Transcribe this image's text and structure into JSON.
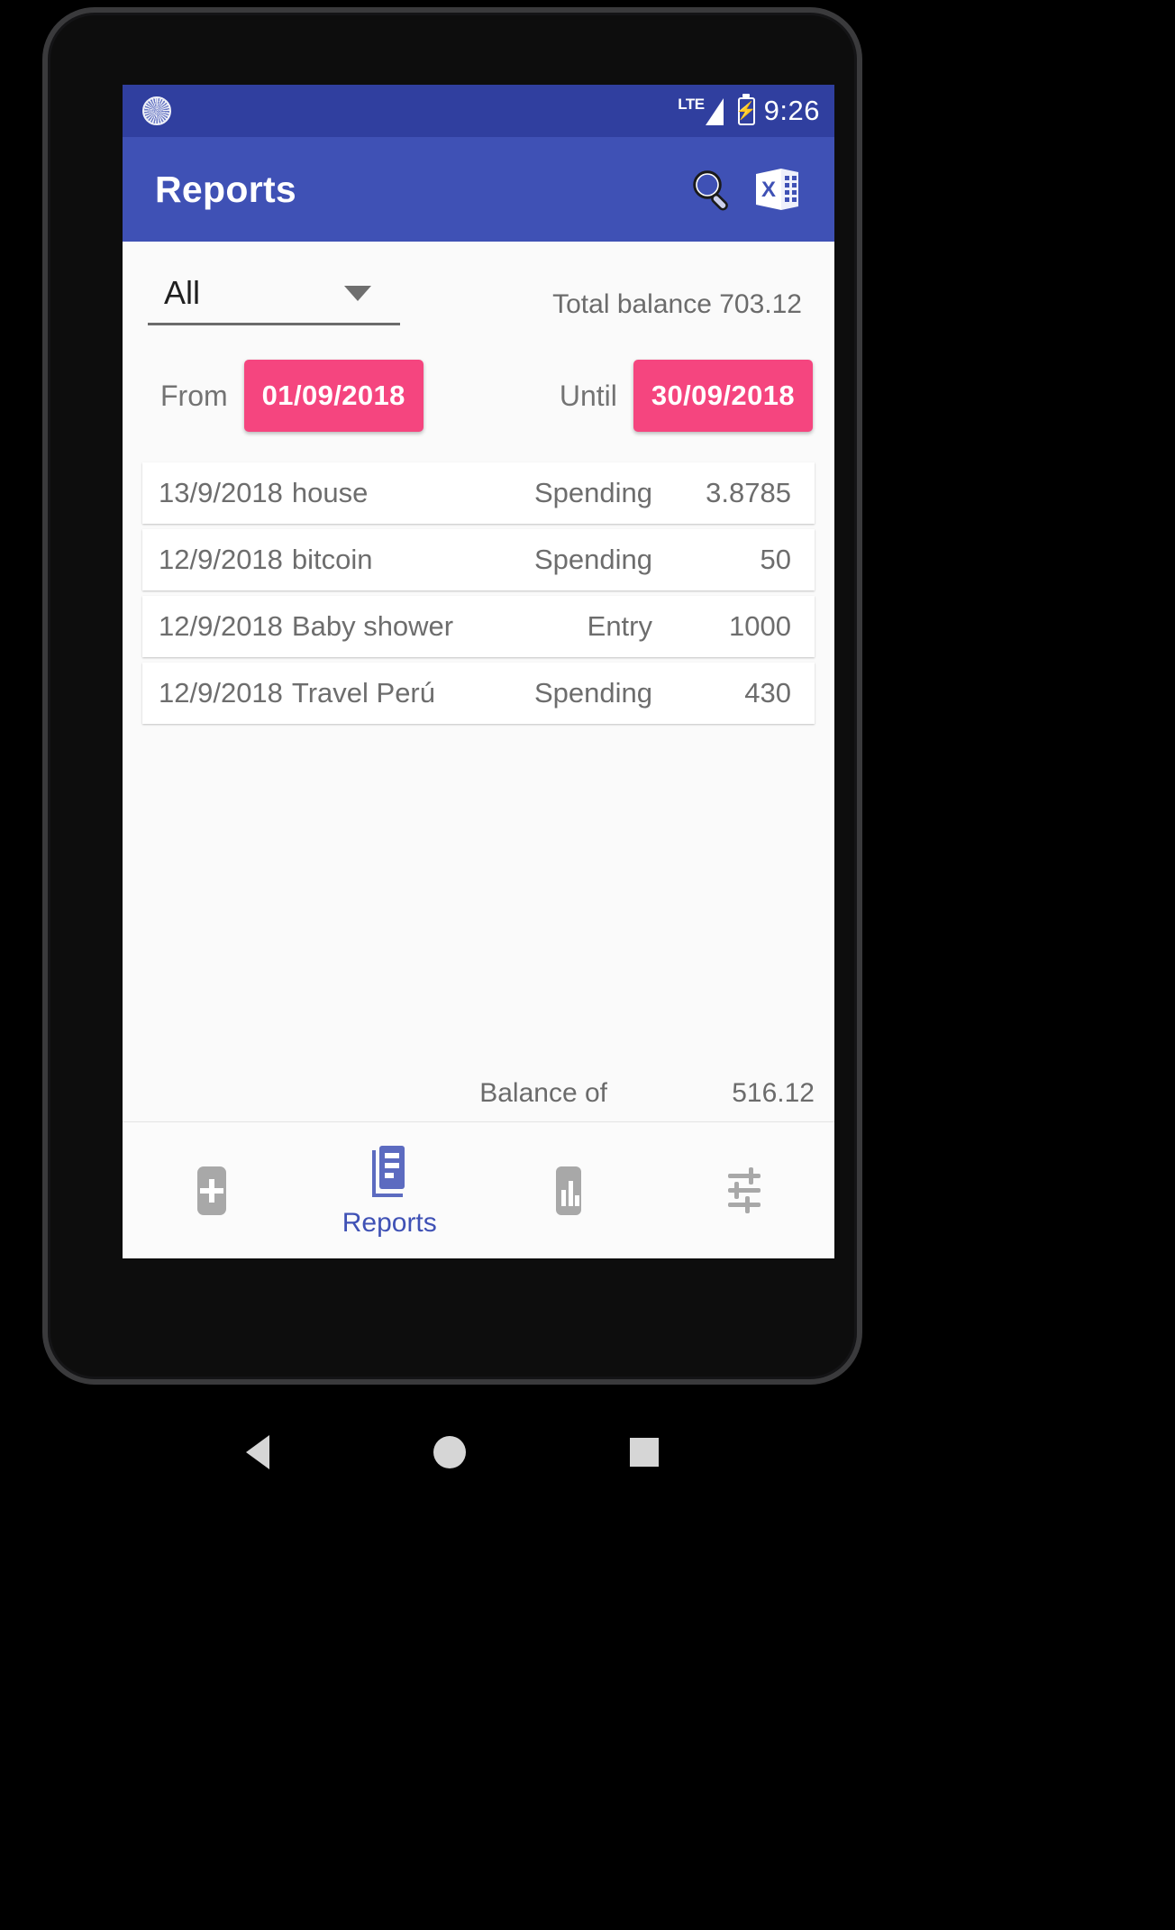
{
  "status_bar": {
    "spinner_icon": "spinner-icon",
    "network_label": "LTE",
    "signal_icon": "signal-bars-icon",
    "battery_icon": "battery-charging-icon",
    "battery_bolt": "⚡",
    "time": "9:26"
  },
  "app_bar": {
    "title": "Reports",
    "search_icon": "search-icon",
    "export_icon": "excel-export-icon"
  },
  "filter": {
    "account_selected": "All",
    "dropdown_icon": "chevron-down-icon",
    "total_balance": "Total balance 703.12"
  },
  "date_range": {
    "from_label": "From",
    "from_value": "01/09/2018",
    "until_label": "Until",
    "until_value": "30/09/2018"
  },
  "transactions": [
    {
      "date": "13/9/2018",
      "name": "house",
      "type": "Spending",
      "amount": "3.8785"
    },
    {
      "date": "12/9/2018",
      "name": "bitcoin",
      "type": "Spending",
      "amount": "50"
    },
    {
      "date": "12/9/2018",
      "name": "Baby shower",
      "type": "Entry",
      "amount": "1000"
    },
    {
      "date": "12/9/2018",
      "name": "Travel Perú",
      "type": "Spending",
      "amount": "430"
    }
  ],
  "footer": {
    "balance_label": "Balance of",
    "balance_value": "516.12"
  },
  "bottom_nav": [
    {
      "icon": "add-icon",
      "label": ""
    },
    {
      "icon": "reports-icon",
      "label": "Reports"
    },
    {
      "icon": "chart-icon",
      "label": ""
    },
    {
      "icon": "settings-sliders-icon",
      "label": ""
    }
  ],
  "android_nav": {
    "back_icon": "back-triangle-icon",
    "home_icon": "home-circle-icon",
    "recents_icon": "recents-square-icon"
  },
  "colors": {
    "status_bar": "#303f9f",
    "app_bar": "#3f51b5",
    "accent_pink": "#f5457f",
    "nav_active": "#3f51b5",
    "nav_inactive": "#a8a8a8"
  }
}
